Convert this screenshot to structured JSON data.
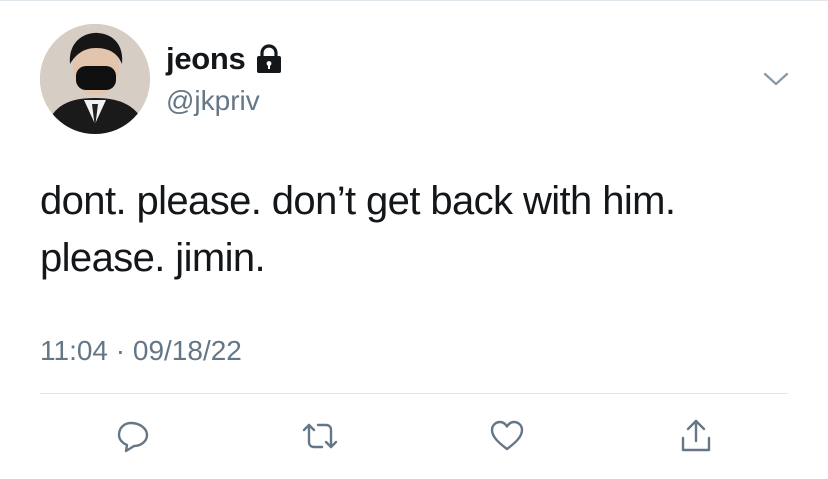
{
  "tweet": {
    "display_name": "jeons",
    "handle": "@jkpriv",
    "protected_icon": "lock-icon",
    "text_lines": [
      "dont. please. don’t get back with him.",
      "please. jimin."
    ],
    "timestamp": "11:04 · 09/18/22"
  },
  "menu": {
    "icon": "chevron-down-icon"
  },
  "actions": [
    {
      "name": "reply",
      "icon": "reply-icon"
    },
    {
      "name": "retweet",
      "icon": "retweet-icon"
    },
    {
      "name": "like",
      "icon": "heart-icon"
    },
    {
      "name": "share",
      "icon": "share-icon"
    }
  ],
  "colors": {
    "text": "#14171a",
    "secondary_text": "#657786",
    "divider": "#e1e8ed"
  }
}
